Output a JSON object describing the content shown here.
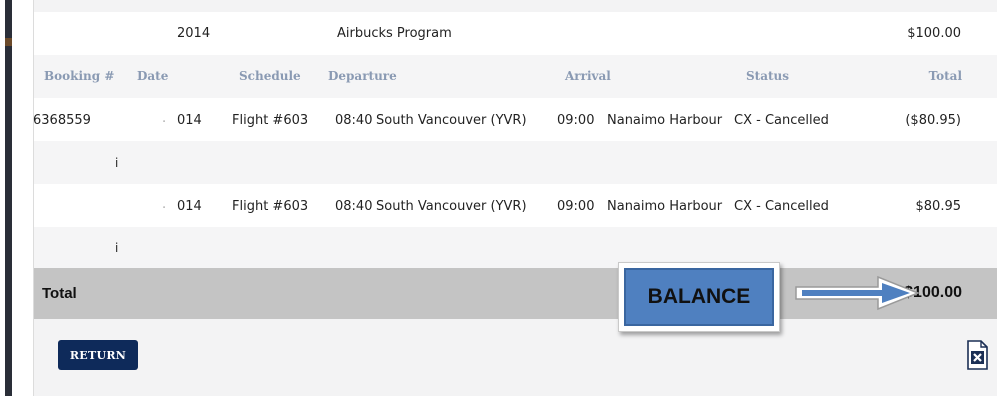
{
  "program_row": {
    "year": "2014",
    "program": "Airbucks Program",
    "amount": "$100.00"
  },
  "table": {
    "headers": {
      "booking": "Booking #",
      "date": "Date",
      "schedule": "Schedule",
      "departure": "Departure",
      "arrival": "Arrival",
      "status": "Status",
      "total": "Total"
    },
    "rows": [
      {
        "booking": "6368559",
        "date_prefix": ".",
        "date": "014",
        "flight": "Flight #603",
        "dep_time": "08:40",
        "dep_place": "South Vancouver (YVR)",
        "arr_time": "09:00",
        "arr_place": "Nanaimo Harbour",
        "status": "CX - Cancelled",
        "total": "($80.95)",
        "note": "i"
      },
      {
        "booking": "",
        "date_prefix": ".",
        "date": "014",
        "flight": "Flight #603",
        "dep_time": "08:40",
        "dep_place": "South Vancouver (YVR)",
        "arr_time": "09:00",
        "arr_place": "Nanaimo Harbour",
        "status": "CX - Cancelled",
        "total": "$80.95",
        "note": "i"
      }
    ]
  },
  "totals": {
    "label": "Total",
    "amount": "$100.00",
    "balance_label": "BALANCE"
  },
  "actions": {
    "return_label": "RETURN",
    "export_icon": "excel-export-icon"
  },
  "colors": {
    "header_text": "#8a9ab3",
    "total_bar": "#c4c4c4",
    "balance_fill": "#4f80c0",
    "return_button": "#0e2a5a",
    "arrow": "#4f80c0"
  }
}
